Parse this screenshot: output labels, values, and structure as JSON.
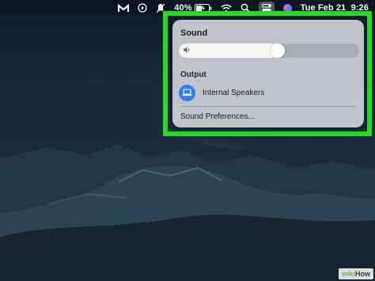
{
  "menubar": {
    "icons": [
      "gmail-icon",
      "play-circle-icon",
      "mute-icon",
      "battery-icon",
      "wifi-icon",
      "search-icon",
      "control-center-icon",
      "siri-icon"
    ],
    "battery_percent": "40%",
    "clock": "Tue Feb 21  9:26"
  },
  "sound_panel": {
    "title": "Sound",
    "volume_level": 0.55,
    "output_section_label": "Output",
    "output_device": {
      "name": "Internal Speakers",
      "icon": "laptop-icon",
      "selected": true
    },
    "preferences_label": "Sound Preferences..."
  },
  "highlight_color": "#22dd22",
  "accent_color": "#2f7df5",
  "watermark": {
    "part1": "wiki",
    "part2": "How"
  }
}
